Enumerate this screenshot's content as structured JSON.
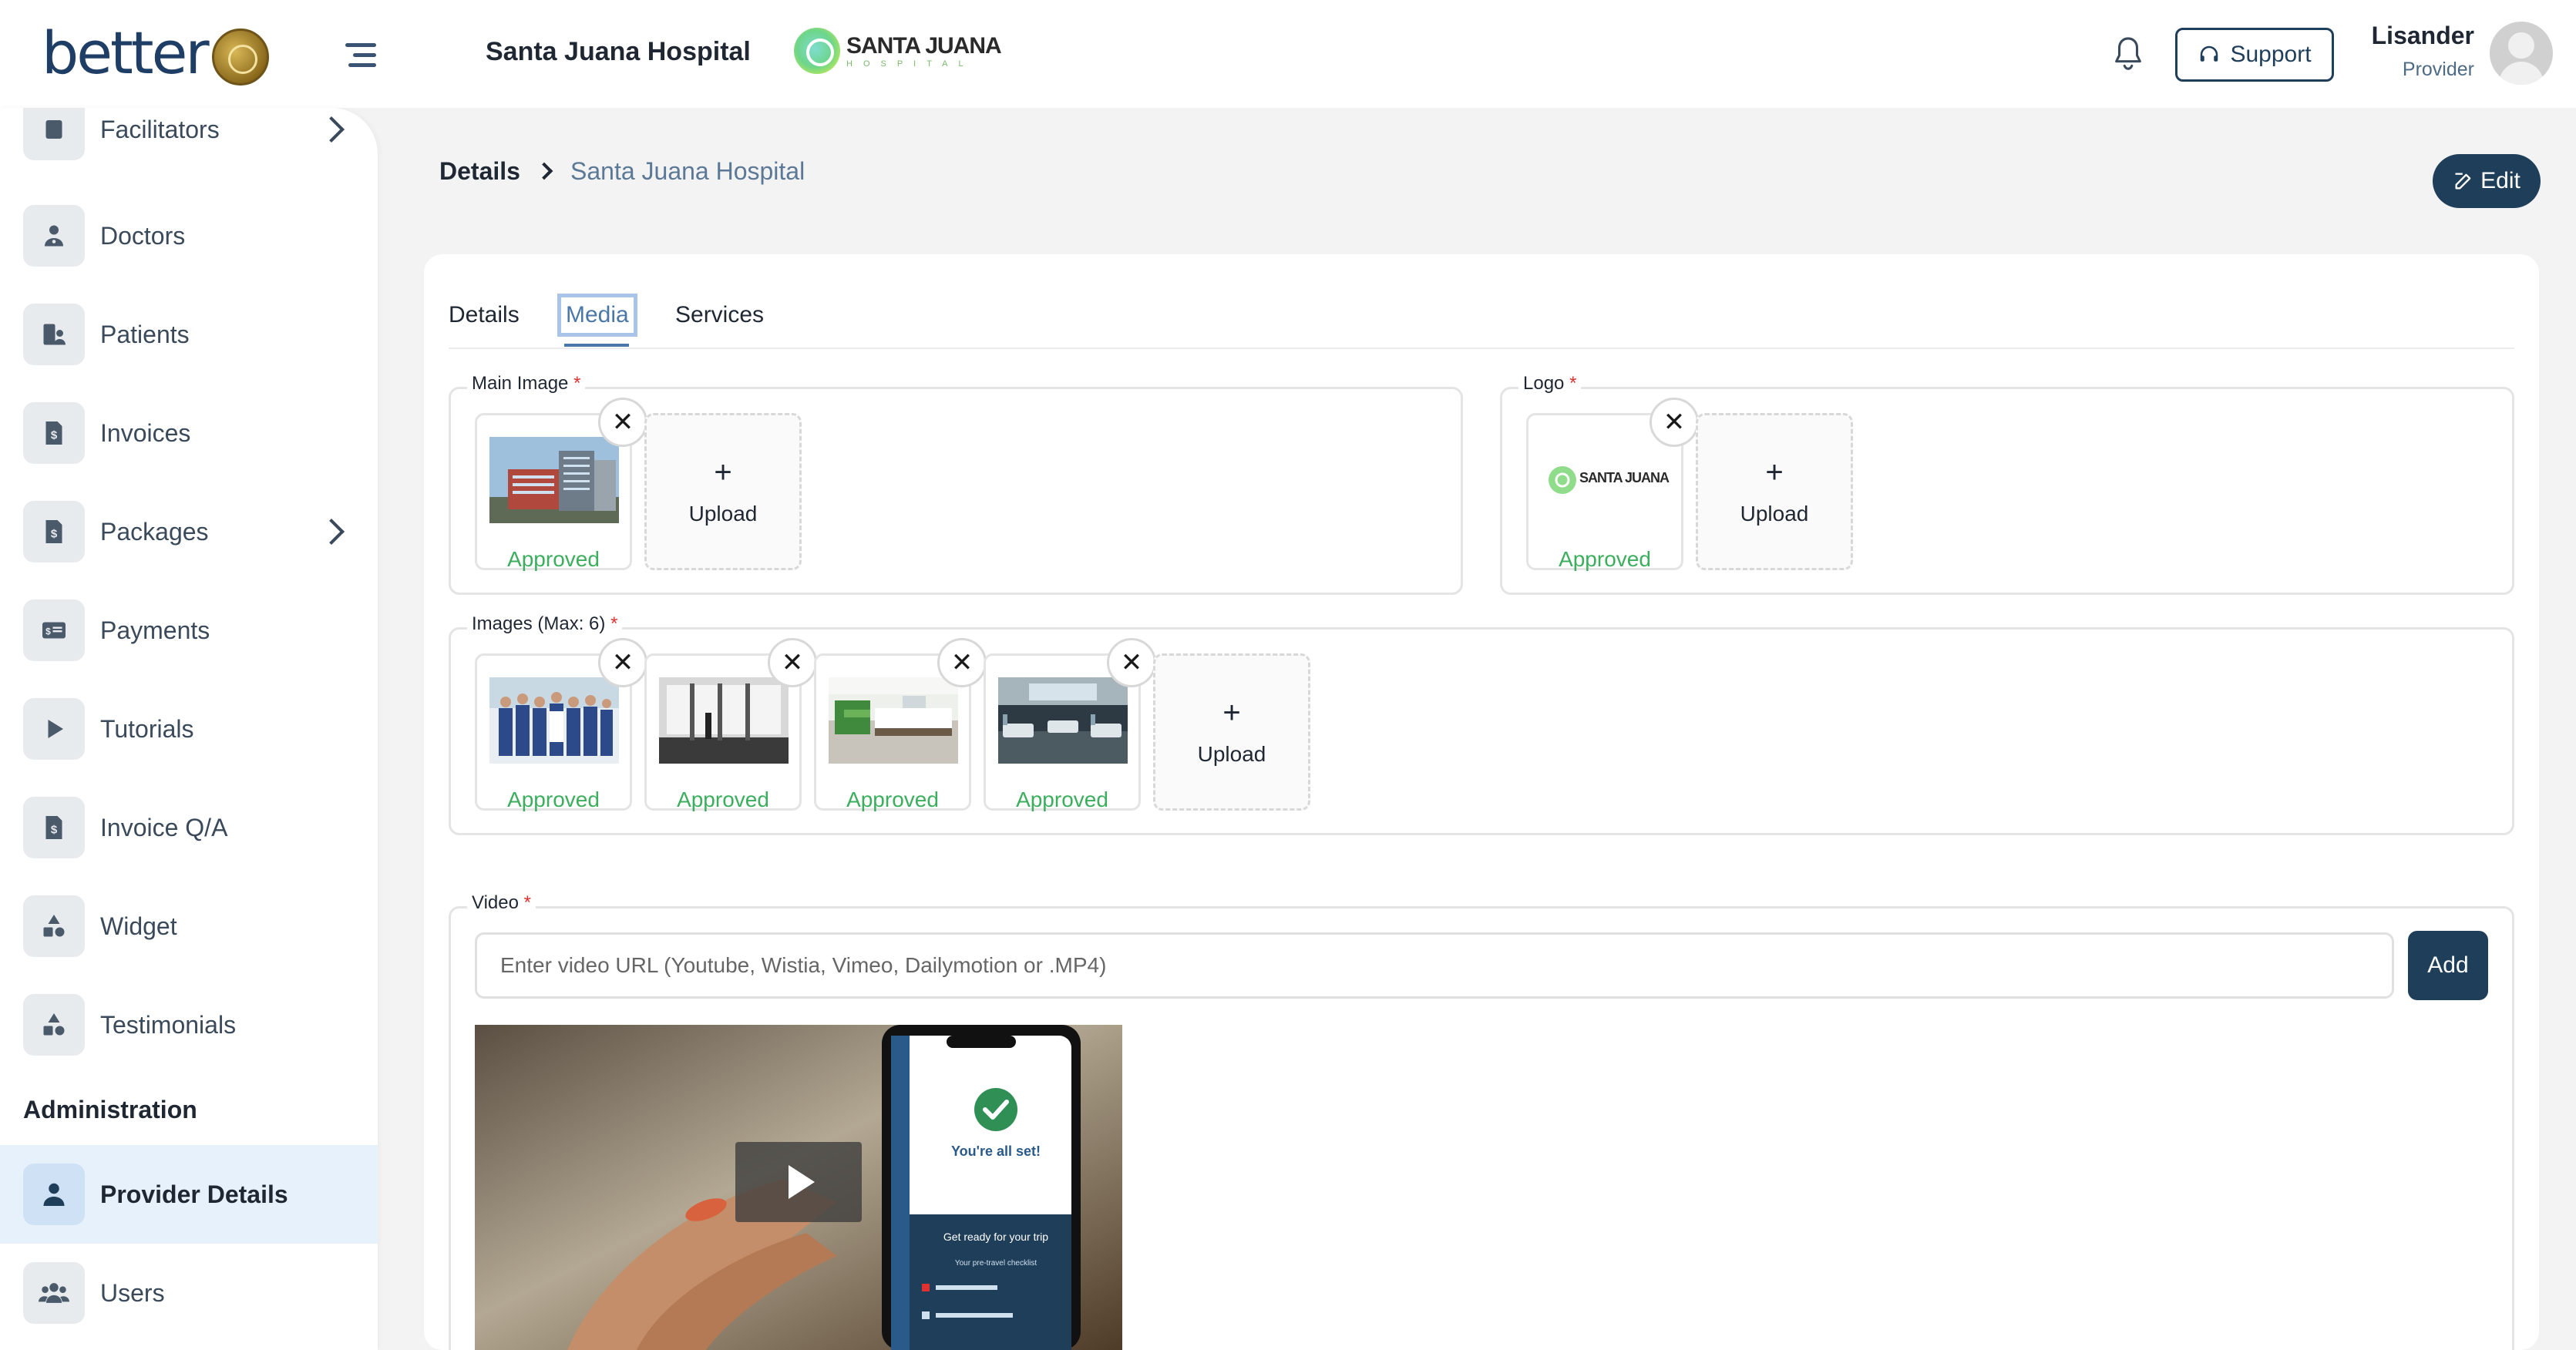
{
  "header": {
    "brand": "better",
    "hospital_name": "Santa Juana Hospital",
    "hospital_logo_line1": "SANTA JUANA",
    "hospital_logo_line2": "HOSPITAL",
    "support_label": "Support",
    "user_name": "Lisander",
    "user_role": "Provider"
  },
  "sidebar": {
    "items": [
      {
        "label": "Facilitators",
        "icon": "facilitators-icon",
        "chevron": true
      },
      {
        "label": "Doctors",
        "icon": "doctor-icon"
      },
      {
        "label": "Patients",
        "icon": "patients-icon"
      },
      {
        "label": "Invoices",
        "icon": "invoice-icon"
      },
      {
        "label": "Packages",
        "icon": "package-icon",
        "chevron": true
      },
      {
        "label": "Payments",
        "icon": "payment-icon"
      },
      {
        "label": "Tutorials",
        "icon": "play-icon"
      },
      {
        "label": "Invoice Q/A",
        "icon": "invoice-qa-icon"
      },
      {
        "label": "Widget",
        "icon": "shapes-icon"
      },
      {
        "label": "Testimonials",
        "icon": "shapes-icon"
      }
    ],
    "section_title": "Administration",
    "admin_items": [
      {
        "label": "Provider Details",
        "icon": "user-icon",
        "active": true
      },
      {
        "label": "Users",
        "icon": "users-icon"
      }
    ]
  },
  "breadcrumb": {
    "root": "Details",
    "current": "Santa Juana Hospital"
  },
  "edit_label": "Edit",
  "tabs": [
    {
      "label": "Details"
    },
    {
      "label": "Media",
      "active": true
    },
    {
      "label": "Services"
    }
  ],
  "media": {
    "main_image_label": "Main Image",
    "logo_label": "Logo",
    "images_label": "Images (Max: 6)",
    "video_label": "Video",
    "required_mark": "*",
    "upload_label": "Upload",
    "upload_plus": "+",
    "close_glyph": "✕",
    "status_approved": "Approved",
    "video_placeholder": "Enter video URL (Youtube, Wistia, Vimeo, Dailymotion or .MP4)",
    "add_label": "Add",
    "video_phone_title": "You're all set!",
    "video_phone_sub": "Get ready for your trip",
    "video_phone_sub2": "Your pre-travel checklist"
  },
  "colors": {
    "primary": "#1f3e5a",
    "approved": "#3cae5d",
    "required": "#e03131",
    "active_tab": "#4a77a8"
  }
}
